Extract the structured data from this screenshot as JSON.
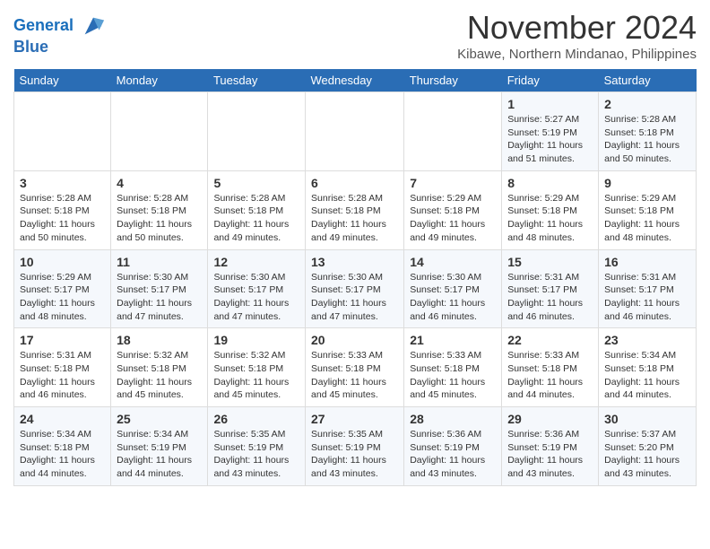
{
  "header": {
    "logo_line1": "General",
    "logo_line2": "Blue",
    "month": "November 2024",
    "location": "Kibawe, Northern Mindanao, Philippines"
  },
  "weekdays": [
    "Sunday",
    "Monday",
    "Tuesday",
    "Wednesday",
    "Thursday",
    "Friday",
    "Saturday"
  ],
  "weeks": [
    [
      {
        "day": "",
        "info": ""
      },
      {
        "day": "",
        "info": ""
      },
      {
        "day": "",
        "info": ""
      },
      {
        "day": "",
        "info": ""
      },
      {
        "day": "",
        "info": ""
      },
      {
        "day": "1",
        "info": "Sunrise: 5:27 AM\nSunset: 5:19 PM\nDaylight: 11 hours\nand 51 minutes."
      },
      {
        "day": "2",
        "info": "Sunrise: 5:28 AM\nSunset: 5:18 PM\nDaylight: 11 hours\nand 50 minutes."
      }
    ],
    [
      {
        "day": "3",
        "info": "Sunrise: 5:28 AM\nSunset: 5:18 PM\nDaylight: 11 hours\nand 50 minutes."
      },
      {
        "day": "4",
        "info": "Sunrise: 5:28 AM\nSunset: 5:18 PM\nDaylight: 11 hours\nand 50 minutes."
      },
      {
        "day": "5",
        "info": "Sunrise: 5:28 AM\nSunset: 5:18 PM\nDaylight: 11 hours\nand 49 minutes."
      },
      {
        "day": "6",
        "info": "Sunrise: 5:28 AM\nSunset: 5:18 PM\nDaylight: 11 hours\nand 49 minutes."
      },
      {
        "day": "7",
        "info": "Sunrise: 5:29 AM\nSunset: 5:18 PM\nDaylight: 11 hours\nand 49 minutes."
      },
      {
        "day": "8",
        "info": "Sunrise: 5:29 AM\nSunset: 5:18 PM\nDaylight: 11 hours\nand 48 minutes."
      },
      {
        "day": "9",
        "info": "Sunrise: 5:29 AM\nSunset: 5:18 PM\nDaylight: 11 hours\nand 48 minutes."
      }
    ],
    [
      {
        "day": "10",
        "info": "Sunrise: 5:29 AM\nSunset: 5:17 PM\nDaylight: 11 hours\nand 48 minutes."
      },
      {
        "day": "11",
        "info": "Sunrise: 5:30 AM\nSunset: 5:17 PM\nDaylight: 11 hours\nand 47 minutes."
      },
      {
        "day": "12",
        "info": "Sunrise: 5:30 AM\nSunset: 5:17 PM\nDaylight: 11 hours\nand 47 minutes."
      },
      {
        "day": "13",
        "info": "Sunrise: 5:30 AM\nSunset: 5:17 PM\nDaylight: 11 hours\nand 47 minutes."
      },
      {
        "day": "14",
        "info": "Sunrise: 5:30 AM\nSunset: 5:17 PM\nDaylight: 11 hours\nand 46 minutes."
      },
      {
        "day": "15",
        "info": "Sunrise: 5:31 AM\nSunset: 5:17 PM\nDaylight: 11 hours\nand 46 minutes."
      },
      {
        "day": "16",
        "info": "Sunrise: 5:31 AM\nSunset: 5:17 PM\nDaylight: 11 hours\nand 46 minutes."
      }
    ],
    [
      {
        "day": "17",
        "info": "Sunrise: 5:31 AM\nSunset: 5:18 PM\nDaylight: 11 hours\nand 46 minutes."
      },
      {
        "day": "18",
        "info": "Sunrise: 5:32 AM\nSunset: 5:18 PM\nDaylight: 11 hours\nand 45 minutes."
      },
      {
        "day": "19",
        "info": "Sunrise: 5:32 AM\nSunset: 5:18 PM\nDaylight: 11 hours\nand 45 minutes."
      },
      {
        "day": "20",
        "info": "Sunrise: 5:33 AM\nSunset: 5:18 PM\nDaylight: 11 hours\nand 45 minutes."
      },
      {
        "day": "21",
        "info": "Sunrise: 5:33 AM\nSunset: 5:18 PM\nDaylight: 11 hours\nand 45 minutes."
      },
      {
        "day": "22",
        "info": "Sunrise: 5:33 AM\nSunset: 5:18 PM\nDaylight: 11 hours\nand 44 minutes."
      },
      {
        "day": "23",
        "info": "Sunrise: 5:34 AM\nSunset: 5:18 PM\nDaylight: 11 hours\nand 44 minutes."
      }
    ],
    [
      {
        "day": "24",
        "info": "Sunrise: 5:34 AM\nSunset: 5:18 PM\nDaylight: 11 hours\nand 44 minutes."
      },
      {
        "day": "25",
        "info": "Sunrise: 5:34 AM\nSunset: 5:19 PM\nDaylight: 11 hours\nand 44 minutes."
      },
      {
        "day": "26",
        "info": "Sunrise: 5:35 AM\nSunset: 5:19 PM\nDaylight: 11 hours\nand 43 minutes."
      },
      {
        "day": "27",
        "info": "Sunrise: 5:35 AM\nSunset: 5:19 PM\nDaylight: 11 hours\nand 43 minutes."
      },
      {
        "day": "28",
        "info": "Sunrise: 5:36 AM\nSunset: 5:19 PM\nDaylight: 11 hours\nand 43 minutes."
      },
      {
        "day": "29",
        "info": "Sunrise: 5:36 AM\nSunset: 5:19 PM\nDaylight: 11 hours\nand 43 minutes."
      },
      {
        "day": "30",
        "info": "Sunrise: 5:37 AM\nSunset: 5:20 PM\nDaylight: 11 hours\nand 43 minutes."
      }
    ]
  ]
}
